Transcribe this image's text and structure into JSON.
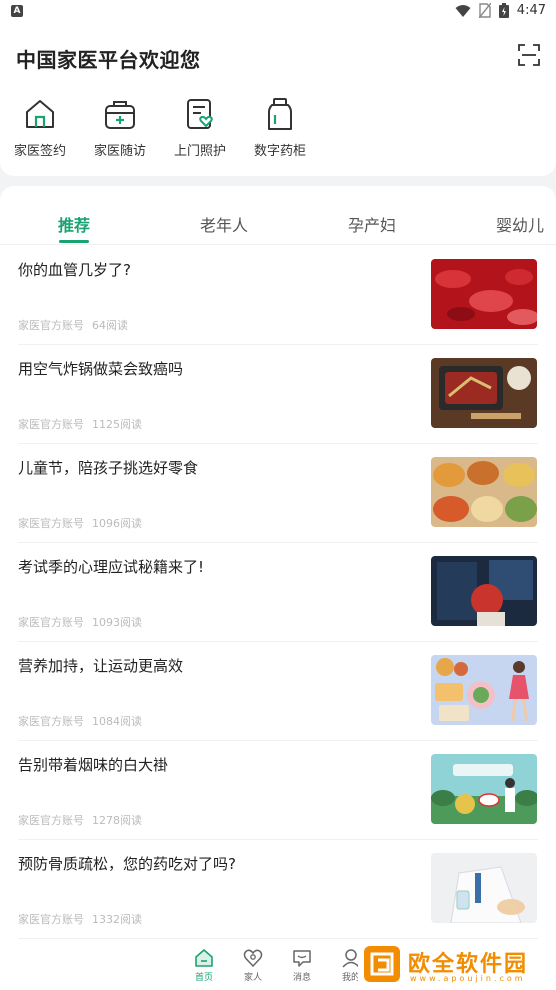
{
  "status_bar": {
    "time": "4:47",
    "a_badge": "A"
  },
  "header": {
    "title": "中国家医平台欢迎您",
    "quick_actions": [
      {
        "label": "家医签约",
        "icon": "home-icon"
      },
      {
        "label": "家医随访",
        "icon": "medical-box-icon"
      },
      {
        "label": "上门照护",
        "icon": "care-card-icon"
      },
      {
        "label": "数字药柜",
        "icon": "medicine-bottle-icon"
      }
    ]
  },
  "tabs": [
    "推荐",
    "老年人",
    "孕产妇",
    "婴幼儿"
  ],
  "active_tab": 0,
  "articles": [
    {
      "title": "你的血管几岁了?",
      "source": "家医官方账号",
      "reads": "64阅读"
    },
    {
      "title": "用空气炸锅做菜会致癌吗",
      "source": "家医官方账号",
      "reads": "1125阅读"
    },
    {
      "title": "儿童节，陪孩子挑选好零食",
      "source": "家医官方账号",
      "reads": "1096阅读"
    },
    {
      "title": "考试季的心理应试秘籍来了!",
      "source": "家医官方账号",
      "reads": "1093阅读"
    },
    {
      "title": "营养加持，让运动更高效",
      "source": "家医官方账号",
      "reads": "1084阅读"
    },
    {
      "title": "告别带着烟味的白大褂",
      "source": "家医官方账号",
      "reads": "1278阅读"
    },
    {
      "title": "预防骨质疏松，您的药吃对了吗?",
      "source": "家医官方账号",
      "reads": "1332阅读"
    }
  ],
  "bottom_nav": [
    {
      "label": "首页",
      "icon": "home-nav-icon"
    },
    {
      "label": "家人",
      "icon": "family-nav-icon"
    },
    {
      "label": "消息",
      "icon": "message-nav-icon"
    },
    {
      "label": "我的",
      "icon": "profile-nav-icon"
    }
  ],
  "watermark": {
    "text": "欧全软件园",
    "url": "www.apoujin.com"
  },
  "colors": {
    "accent": "#1aa371",
    "watermark": "#f28c00"
  }
}
